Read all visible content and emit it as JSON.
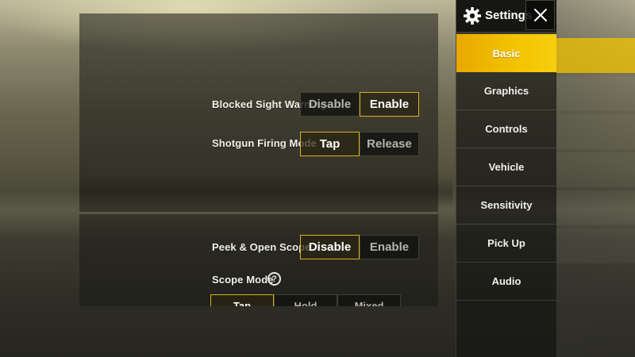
{
  "header": {
    "title": "Settings",
    "settings_icon": "gear-icon",
    "close_icon": "close-icon"
  },
  "sidebar": {
    "items": [
      {
        "label": "Basic",
        "active": true
      },
      {
        "label": "Graphics",
        "active": false
      },
      {
        "label": "Controls",
        "active": false
      },
      {
        "label": "Vehicle",
        "active": false
      },
      {
        "label": "Sensitivity",
        "active": false
      },
      {
        "label": "Pick Up",
        "active": false
      },
      {
        "label": "Audio",
        "active": false
      }
    ]
  },
  "settings": {
    "blocked_sight_warning": {
      "label": "Blocked Sight Warning",
      "options": [
        "Disable",
        "Enable"
      ],
      "selected": "Enable"
    },
    "shotgun_firing_mode": {
      "label": "Shotgun Firing Mode",
      "options": [
        "Tap",
        "Release"
      ],
      "selected": "Tap"
    },
    "peek_open_scope": {
      "label": "Peek & Open Scope",
      "options": [
        "Disable",
        "Enable"
      ],
      "selected": "Disable"
    },
    "scope_mode": {
      "label": "Scope Mode",
      "help_icon": "help-icon",
      "help_glyph": "?",
      "options": [
        "Tap",
        "Hold",
        "Mixed"
      ],
      "selected": "Tap"
    }
  },
  "colors": {
    "accent": "#f3c400",
    "selected_border": "#d8b020"
  }
}
